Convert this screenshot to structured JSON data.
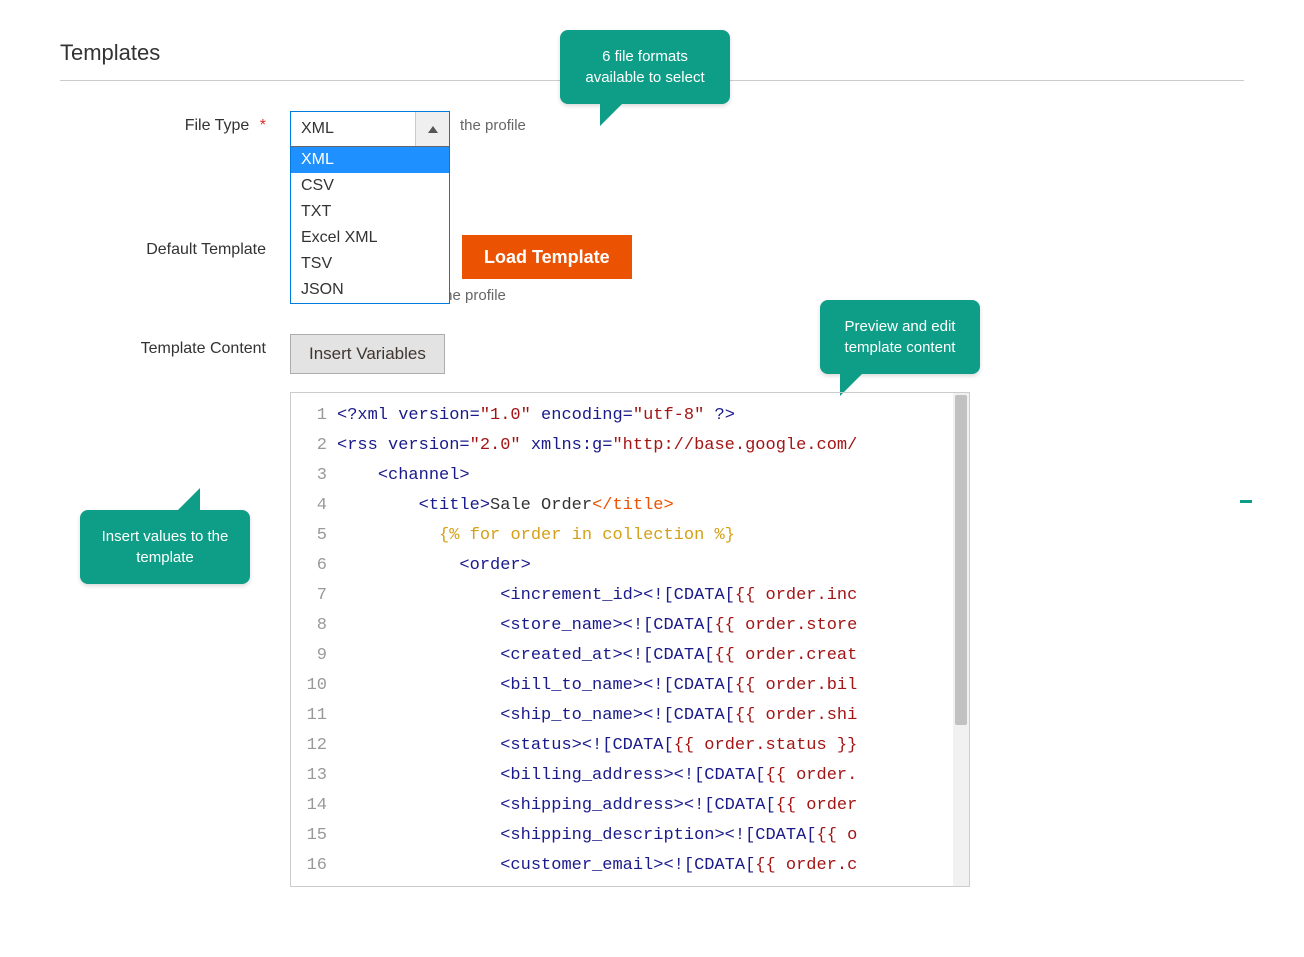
{
  "section": {
    "title": "Templates"
  },
  "fields": {
    "file_type": {
      "label": "File Type",
      "required_mark": "*",
      "value": "XML",
      "options": [
        "XML",
        "CSV",
        "TXT",
        "Excel XML",
        "TSV",
        "JSON"
      ],
      "helper": "the profile"
    },
    "default_template": {
      "label": "Default Template",
      "button": "Load Template",
      "helper": "the profile"
    },
    "template_content": {
      "label": "Template Content",
      "insert_button": "Insert Variables"
    }
  },
  "callouts": {
    "formats": "6 file formats available to select",
    "preview": "Preview and edit template content",
    "insert": "Insert values to the template"
  },
  "editor": {
    "lines": [
      {
        "n": "1",
        "segs": [
          {
            "t": "<?",
            "c": "tag"
          },
          {
            "t": "xml version=",
            "c": "tag"
          },
          {
            "t": "\"1.0\"",
            "c": "str"
          },
          {
            "t": " encoding=",
            "c": "tag"
          },
          {
            "t": "\"utf-8\"",
            "c": "str"
          },
          {
            "t": " ?>",
            "c": "tag"
          }
        ]
      },
      {
        "n": "2",
        "segs": [
          {
            "t": "<",
            "c": "tag"
          },
          {
            "t": "rss version=",
            "c": "tag"
          },
          {
            "t": "\"2.0\"",
            "c": "str"
          },
          {
            "t": " xmlns:g=",
            "c": "tag"
          },
          {
            "t": "\"http://base.google.com/",
            "c": "str"
          }
        ]
      },
      {
        "n": "3",
        "segs": [
          {
            "t": "    ",
            "c": ""
          },
          {
            "t": "<channel>",
            "c": "tag"
          }
        ]
      },
      {
        "n": "4",
        "segs": [
          {
            "t": "        ",
            "c": ""
          },
          {
            "t": "<title>",
            "c": "tag"
          },
          {
            "t": "Sale Order",
            "c": ""
          },
          {
            "t": "</title>",
            "c": "close"
          }
        ]
      },
      {
        "n": "5",
        "segs": [
          {
            "t": "          ",
            "c": ""
          },
          {
            "t": "{% for order in collection %}",
            "c": "liq"
          }
        ]
      },
      {
        "n": "6",
        "segs": [
          {
            "t": "            ",
            "c": ""
          },
          {
            "t": "<order>",
            "c": "tag"
          }
        ]
      },
      {
        "n": "7",
        "segs": [
          {
            "t": "                ",
            "c": ""
          },
          {
            "t": "<increment_id>",
            "c": "tag"
          },
          {
            "t": "<![CDATA[",
            "c": "tag"
          },
          {
            "t": "{{ order.inc",
            "c": "var"
          }
        ]
      },
      {
        "n": "8",
        "segs": [
          {
            "t": "                ",
            "c": ""
          },
          {
            "t": "<store_name>",
            "c": "tag"
          },
          {
            "t": "<![CDATA[",
            "c": "tag"
          },
          {
            "t": "{{ order.store",
            "c": "var"
          }
        ]
      },
      {
        "n": "9",
        "segs": [
          {
            "t": "                ",
            "c": ""
          },
          {
            "t": "<created_at>",
            "c": "tag"
          },
          {
            "t": "<![CDATA[",
            "c": "tag"
          },
          {
            "t": "{{ order.creat",
            "c": "var"
          }
        ]
      },
      {
        "n": "10",
        "segs": [
          {
            "t": "                ",
            "c": ""
          },
          {
            "t": "<bill_to_name>",
            "c": "tag"
          },
          {
            "t": "<![CDATA[",
            "c": "tag"
          },
          {
            "t": "{{ order.bil",
            "c": "var"
          }
        ]
      },
      {
        "n": "11",
        "segs": [
          {
            "t": "                ",
            "c": ""
          },
          {
            "t": "<ship_to_name>",
            "c": "tag"
          },
          {
            "t": "<![CDATA[",
            "c": "tag"
          },
          {
            "t": "{{ order.shi",
            "c": "var"
          }
        ]
      },
      {
        "n": "12",
        "segs": [
          {
            "t": "                ",
            "c": ""
          },
          {
            "t": "<status>",
            "c": "tag"
          },
          {
            "t": "<![CDATA[",
            "c": "tag"
          },
          {
            "t": "{{ order.status }}",
            "c": "var"
          }
        ]
      },
      {
        "n": "13",
        "segs": [
          {
            "t": "                ",
            "c": ""
          },
          {
            "t": "<billing_address>",
            "c": "tag"
          },
          {
            "t": "<![CDATA[",
            "c": "tag"
          },
          {
            "t": "{{ order.",
            "c": "var"
          }
        ]
      },
      {
        "n": "14",
        "segs": [
          {
            "t": "                ",
            "c": ""
          },
          {
            "t": "<shipping_address>",
            "c": "tag"
          },
          {
            "t": "<![CDATA[",
            "c": "tag"
          },
          {
            "t": "{{ order",
            "c": "var"
          }
        ]
      },
      {
        "n": "15",
        "segs": [
          {
            "t": "                ",
            "c": ""
          },
          {
            "t": "<shipping_description>",
            "c": "tag"
          },
          {
            "t": "<![CDATA[",
            "c": "tag"
          },
          {
            "t": "{{ o",
            "c": "var"
          }
        ]
      },
      {
        "n": "16",
        "segs": [
          {
            "t": "                ",
            "c": ""
          },
          {
            "t": "<customer_email>",
            "c": "tag"
          },
          {
            "t": "<![CDATA[",
            "c": "tag"
          },
          {
            "t": "{{ order.c",
            "c": "var"
          }
        ]
      }
    ]
  }
}
